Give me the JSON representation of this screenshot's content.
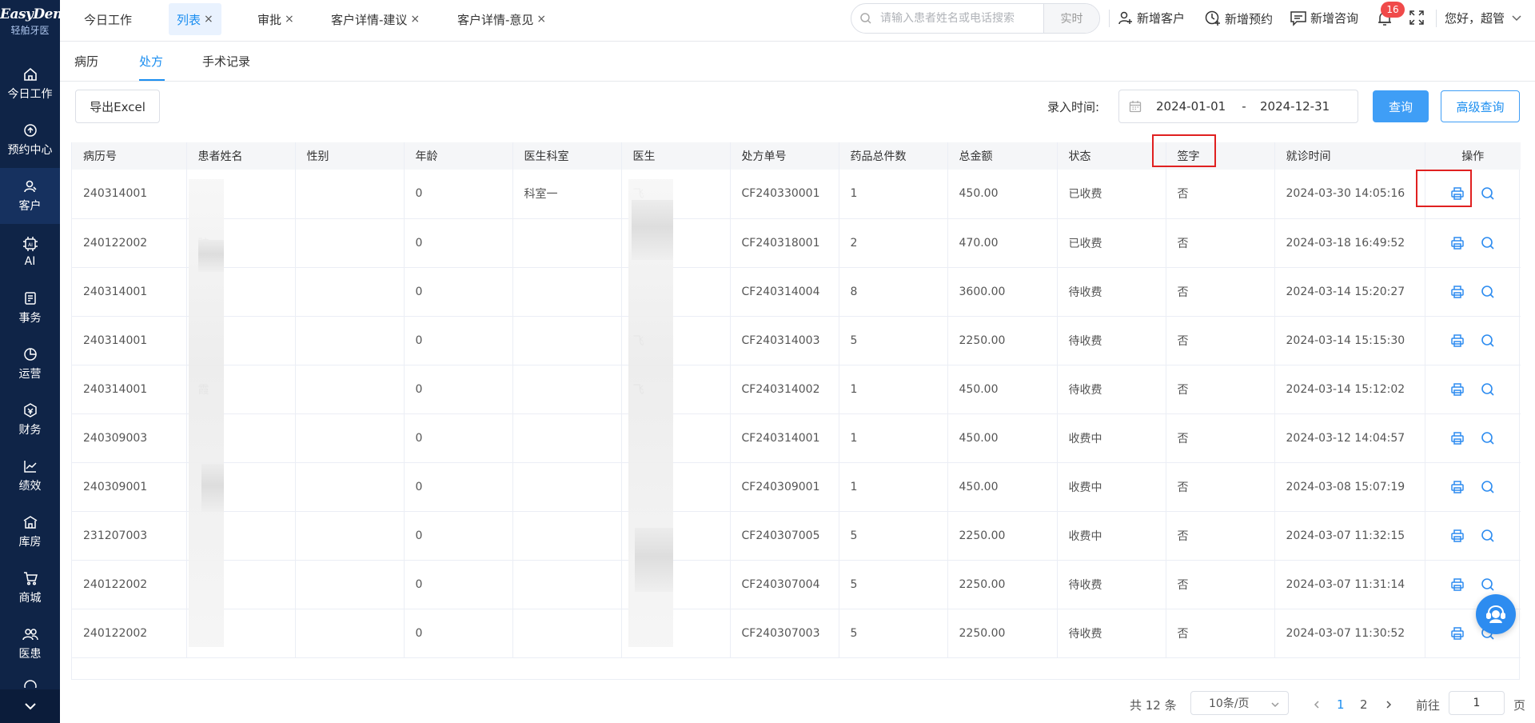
{
  "sidebar": {
    "logo": {
      "brand": "EasyDent",
      "sub": "轻舶牙医"
    },
    "items": [
      {
        "label": "今日工作",
        "icon": "home-icon"
      },
      {
        "label": "预约中心",
        "icon": "appointment-icon"
      },
      {
        "label": "客户",
        "icon": "customer-icon",
        "active": true
      },
      {
        "label": "AI",
        "icon": "ai-icon"
      },
      {
        "label": "事务",
        "icon": "task-icon"
      },
      {
        "label": "运营",
        "icon": "pie-chart-icon"
      },
      {
        "label": "财务",
        "icon": "finance-icon"
      },
      {
        "label": "绩效",
        "icon": "trend-icon"
      },
      {
        "label": "库房",
        "icon": "warehouse-icon"
      },
      {
        "label": "商城",
        "icon": "cart-icon"
      },
      {
        "label": "医患",
        "icon": "doctor-patient-icon"
      }
    ]
  },
  "topbar": {
    "tabs": [
      {
        "label": "今日工作",
        "closable": false
      },
      {
        "label": "列表",
        "closable": true,
        "active": true
      },
      {
        "label": "审批",
        "closable": true
      },
      {
        "label": "客户详情-建议",
        "closable": true
      },
      {
        "label": "客户详情-意见",
        "closable": true
      }
    ],
    "close_glyph": "×",
    "search": {
      "placeholder": "请输入患者姓名或电话搜索",
      "mode": "实时"
    },
    "actions": {
      "new_customer": "新增客户",
      "new_appointment": "新增预约",
      "new_consult": "新增咨询"
    },
    "notification_count": "16",
    "greeting": "您好，超管"
  },
  "subtabs": [
    {
      "label": "病历"
    },
    {
      "label": "处方",
      "active": true
    },
    {
      "label": "手术记录"
    }
  ],
  "toolbar": {
    "export_label": "导出Excel",
    "time_label": "录入时间:",
    "date_start": "2024-01-01",
    "date_sep": "-",
    "date_end": "2024-12-31",
    "query_label": "查询",
    "advanced_label": "高级查询"
  },
  "table": {
    "columns": [
      "病历号",
      "患者姓名",
      "性别",
      "年龄",
      "医生科室",
      "医生",
      "处方单号",
      "药品总件数",
      "总金额",
      "状态",
      "签字",
      "就诊时间",
      "操作"
    ],
    "rows": [
      {
        "record_no": "240314001",
        "patient": "",
        "gender": "",
        "age": "0",
        "dept": "科室一",
        "doctor": "飞",
        "rx_no": "CF240330001",
        "qty": "1",
        "amount": "450.00",
        "status": "已收费",
        "signed": "否",
        "visit_time": "2024-03-30 14:05:16"
      },
      {
        "record_no": "240122002",
        "patient": "旷",
        "gender": "",
        "age": "0",
        "dept": "",
        "doctor": "",
        "rx_no": "CF240318001",
        "qty": "2",
        "amount": "470.00",
        "status": "已收费",
        "signed": "否",
        "visit_time": "2024-03-18 16:49:52"
      },
      {
        "record_no": "240314001",
        "patient": "",
        "gender": "",
        "age": "0",
        "dept": "",
        "doctor": "",
        "rx_no": "CF240314004",
        "qty": "8",
        "amount": "3600.00",
        "status": "待收费",
        "signed": "否",
        "visit_time": "2024-03-14 15:20:27"
      },
      {
        "record_no": "240314001",
        "patient": "",
        "gender": "",
        "age": "0",
        "dept": "",
        "doctor": "飞",
        "rx_no": "CF240314003",
        "qty": "5",
        "amount": "2250.00",
        "status": "待收费",
        "signed": "否",
        "visit_time": "2024-03-14 15:15:30"
      },
      {
        "record_no": "240314001",
        "patient": "霞",
        "gender": "",
        "age": "0",
        "dept": "",
        "doctor": "飞",
        "rx_no": "CF240314002",
        "qty": "1",
        "amount": "450.00",
        "status": "待收费",
        "signed": "否",
        "visit_time": "2024-03-14 15:12:02"
      },
      {
        "record_no": "240309003",
        "patient": "",
        "gender": "",
        "age": "0",
        "dept": "",
        "doctor": "",
        "rx_no": "CF240314001",
        "qty": "1",
        "amount": "450.00",
        "status": "收费中",
        "signed": "否",
        "visit_time": "2024-03-12 14:04:57"
      },
      {
        "record_no": "240309001",
        "patient": "",
        "gender": "",
        "age": "0",
        "dept": "",
        "doctor": "",
        "rx_no": "CF240309001",
        "qty": "1",
        "amount": "450.00",
        "status": "收费中",
        "signed": "否",
        "visit_time": "2024-03-08 15:07:19"
      },
      {
        "record_no": "231207003",
        "patient": "",
        "gender": "",
        "age": "0",
        "dept": "",
        "doctor": "",
        "rx_no": "CF240307005",
        "qty": "5",
        "amount": "2250.00",
        "status": "收费中",
        "signed": "否",
        "visit_time": "2024-03-07 11:32:15"
      },
      {
        "record_no": "240122002",
        "patient": "",
        "gender": "",
        "age": "0",
        "dept": "",
        "doctor": "",
        "rx_no": "CF240307004",
        "qty": "5",
        "amount": "2250.00",
        "status": "待收费",
        "signed": "否",
        "visit_time": "2024-03-07 11:31:14"
      },
      {
        "record_no": "240122002",
        "patient": "",
        "gender": "",
        "age": "0",
        "dept": "",
        "doctor": "",
        "rx_no": "CF240307003",
        "qty": "5",
        "amount": "2250.00",
        "status": "待收费",
        "signed": "否",
        "visit_time": "2024-03-07 11:30:52"
      }
    ],
    "row_actions": [
      "print-icon",
      "search-icon"
    ]
  },
  "pagination": {
    "total": "共 12 条",
    "page_size": "10条/页",
    "pages": [
      "1",
      "2"
    ],
    "current_page": "1",
    "goto_label": "前往",
    "goto_value": "1",
    "page_suffix": "页"
  },
  "colors": {
    "accent": "#1b8ef0",
    "sidebar": "#0f2447",
    "highlight": "#e02020"
  }
}
